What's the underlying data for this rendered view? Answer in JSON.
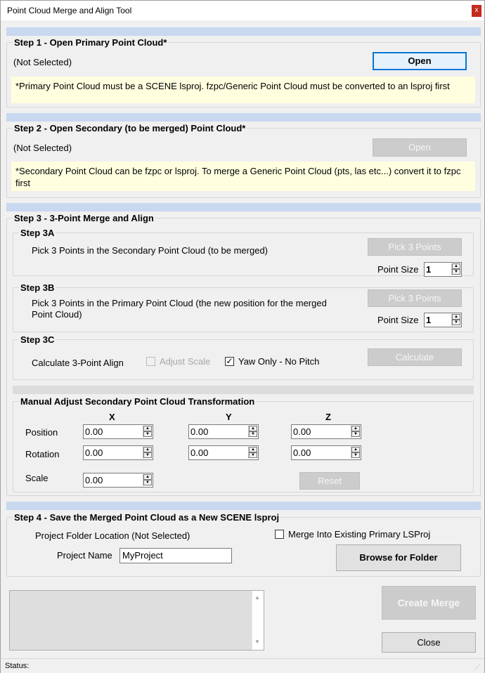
{
  "window": {
    "title": "Point Cloud Merge and Align Tool",
    "close_glyph": "x"
  },
  "step1": {
    "title": "Step 1 - Open Primary Point Cloud*",
    "file": "(Not Selected)",
    "open_label": "Open",
    "note": "*Primary Point Cloud must be a SCENE lsproj.  fzpc/Generic Point Cloud must be converted to an lsproj first"
  },
  "step2": {
    "title": "Step 2 - Open Secondary (to be merged) Point Cloud*",
    "file": "(Not Selected)",
    "open_label": "Open",
    "note": "*Secondary Point Cloud can be fzpc or lsproj.  To merge a Generic Point Cloud (pts, las etc...) convert it to fzpc first"
  },
  "step3": {
    "title": "Step 3 -  3-Point Merge and Align",
    "a": {
      "title": "Step 3A",
      "instruction": "Pick 3 Points in the Secondary Point Cloud (to be merged)",
      "pick_label": "Pick 3 Points",
      "point_size_label": "Point Size",
      "point_size": "1"
    },
    "b": {
      "title": "Step 3B",
      "instruction": "Pick 3 Points in the Primary Point Cloud (the new position for the merged Point Cloud)",
      "pick_label": "Pick 3 Points",
      "point_size_label": "Point Size",
      "point_size": "1"
    },
    "c": {
      "title": "Step 3C",
      "instruction": "Calculate 3-Point Align",
      "adjust_scale_label": "Adjust Scale",
      "adjust_scale_checked": false,
      "yaw_only_label": "Yaw Only - No Pitch",
      "yaw_only_checked": true,
      "calculate_label": "Calculate"
    }
  },
  "manual": {
    "title": "Manual Adjust Secondary Point Cloud Transformation",
    "col_x": "X",
    "col_y": "Y",
    "col_z": "Z",
    "position_label": "Position",
    "rotation_label": "Rotation",
    "scale_label": "Scale",
    "position": {
      "x": "0.00",
      "y": "0.00",
      "z": "0.00"
    },
    "rotation": {
      "x": "0.00",
      "y": "0.00",
      "z": "0.00"
    },
    "scale": "0.00",
    "reset_label": "Reset"
  },
  "step4": {
    "title": "Step 4 - Save the Merged Point Cloud as a New SCENE lsproj",
    "folder_label": "Project Folder Location  (Not Selected)",
    "merge_existing_label": "Merge Into Existing Primary LSProj",
    "merge_existing_checked": false,
    "project_name_label": "Project Name",
    "project_name": "MyProject",
    "browse_label": "Browse for Folder"
  },
  "footer": {
    "create_merge_label": "Create Merge",
    "close_label": "Close",
    "status_label": "Status:"
  },
  "icons": {
    "spin_up": "▲",
    "spin_down": "▼",
    "scroll_up": "▲",
    "scroll_down": "▼",
    "check": "✓"
  }
}
